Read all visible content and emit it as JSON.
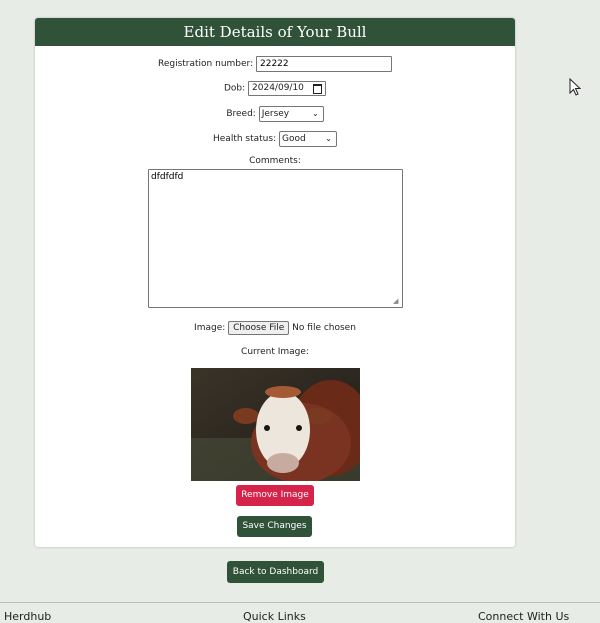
{
  "form": {
    "title": "Edit Details of Your Bull",
    "registration_label": "Registration number:",
    "registration_value": "22222",
    "dob_label": "Dob:",
    "dob_value": "2024/09/10",
    "breed_label": "Breed:",
    "breed_value": "Jersey",
    "health_label": "Health status:",
    "health_value": "Good",
    "comments_label": "Comments:",
    "comments_value": "dfdfdfd",
    "image_label": "Image:",
    "choose_file_label": "Choose File",
    "no_file_text": "No file chosen",
    "current_image_label": "Current Image:",
    "remove_image_label": "Remove Image",
    "save_label": "Save Changes"
  },
  "back_label": "Back to Dashboard",
  "footer": {
    "brand": "Herdhub",
    "quick_links": "Quick Links",
    "connect": "Connect With Us"
  },
  "colors": {
    "accent_green": "#2f5238",
    "danger_red": "#d6234a",
    "page_bg": "#e7ede6"
  },
  "icons": [
    "calendar-icon",
    "chevron-down-icon",
    "mouse-cursor-icon"
  ]
}
